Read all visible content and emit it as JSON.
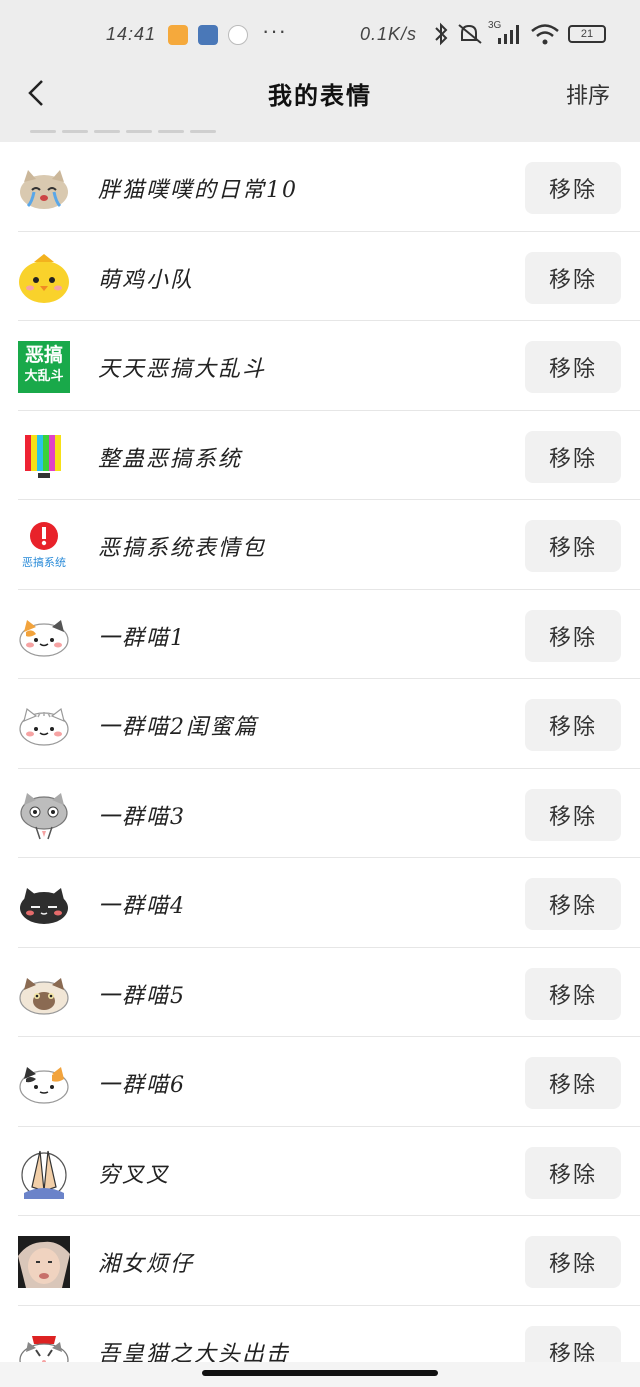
{
  "status_bar": {
    "time": "14:41",
    "dots": "···",
    "network_speed": "0.1K/s",
    "network_type": "3G",
    "battery": "21"
  },
  "header": {
    "title": "我的表情",
    "sort_label": "排序"
  },
  "emoji_packs": [
    {
      "name": "胖猫噗噗的日常10",
      "icon": "crying-cat-icon",
      "action": "移除"
    },
    {
      "name": "萌鸡小队",
      "icon": "yellow-chick-icon",
      "action": "移除"
    },
    {
      "name": "天天恶搞大乱斗",
      "icon": "green-text-badge-icon",
      "icon_text_top": "恶搞",
      "icon_text_bottom": "大乱斗",
      "action": "移除"
    },
    {
      "name": "整蛊恶搞系统",
      "icon": "color-bars-tv-icon",
      "action": "移除"
    },
    {
      "name": "恶搞系统表情包",
      "icon": "red-alert-icon",
      "icon_text": "恶搞系统",
      "action": "移除"
    },
    {
      "name": "一群喵1",
      "icon": "calico-cat-icon",
      "action": "移除"
    },
    {
      "name": "一群喵2闺蜜篇",
      "icon": "white-cat-icon",
      "action": "移除"
    },
    {
      "name": "一群喵3",
      "icon": "gray-tabby-cat-icon",
      "action": "移除"
    },
    {
      "name": "一群喵4",
      "icon": "black-cat-icon",
      "action": "移除"
    },
    {
      "name": "一群喵5",
      "icon": "siamese-cat-icon",
      "action": "移除"
    },
    {
      "name": "一群喵6",
      "icon": "spotted-cat-icon",
      "action": "移除"
    },
    {
      "name": "穷叉叉",
      "icon": "praying-hands-icon",
      "action": "移除"
    },
    {
      "name": "湘女烦仔",
      "icon": "photo-face-icon",
      "action": "移除"
    },
    {
      "name": "吾皇猫之大头出击",
      "icon": "emperor-cat-icon",
      "action": "移除"
    }
  ]
}
